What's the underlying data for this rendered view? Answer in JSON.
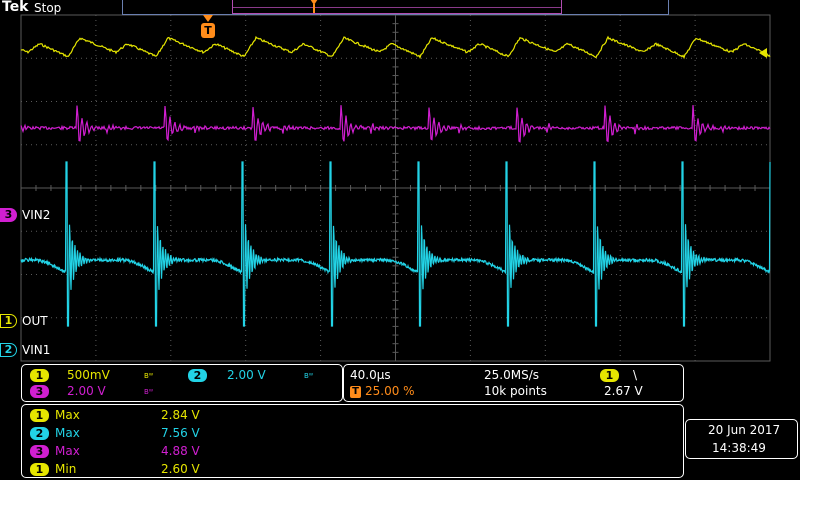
{
  "header": {
    "brand": "Tek",
    "run_state": "Stop"
  },
  "trigger": {
    "marker": "T"
  },
  "channels": {
    "ch1": {
      "num": "1",
      "label": "OUT",
      "scale": "500mV",
      "color": "#e6e600"
    },
    "ch2": {
      "num": "2",
      "label": "VIN1",
      "scale": "2.00 V",
      "color": "#22d3e6"
    },
    "ch3": {
      "num": "3",
      "label": "VIN2",
      "scale": "2.00 V",
      "color": "#d11fd1"
    }
  },
  "bw_mark": "Bᵂ",
  "timebase": {
    "horizontal": "40.0µs",
    "sample_rate": "25.0MS/s",
    "trigger_position": "25.00 %",
    "record_length": "10k points",
    "trigger_source": "1",
    "trigger_slope": "\\",
    "trigger_level": "2.67 V"
  },
  "measurements": [
    {
      "ch": "1",
      "name": "Max",
      "value": "2.84 V"
    },
    {
      "ch": "2",
      "name": "Max",
      "value": "7.56 V"
    },
    {
      "ch": "3",
      "name": "Max",
      "value": "4.88 V"
    },
    {
      "ch": "1",
      "name": "Min",
      "value": "2.60 V"
    }
  ],
  "datetime": {
    "date": "20 Jun  2017",
    "time": "14:38:49"
  },
  "colors": {
    "grid": "#5a5a5a",
    "trigger": "#ff8c1a",
    "record_bar": "#8a3a8a",
    "text_white": "#ffffff"
  }
}
